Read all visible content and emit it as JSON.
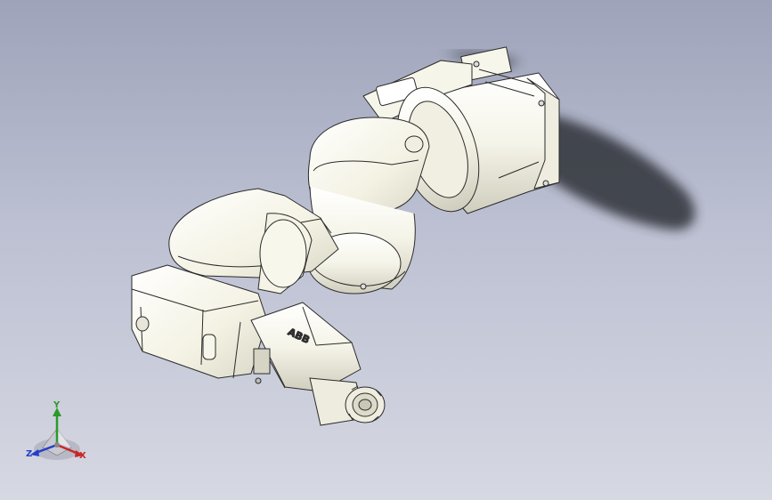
{
  "viewport": {
    "background_top": "#9ea3ba",
    "background_bottom": "#d6d8e2",
    "model_color": "#f4f2e4",
    "edge_color": "#2b2b2b",
    "shadow_color": "#2e2f36"
  },
  "model": {
    "brand_label": "ABB"
  },
  "triad": {
    "x_label": "X",
    "y_label": "Y",
    "z_label": "Z",
    "x_color": "#c62828",
    "y_color": "#2a9a2a",
    "z_color": "#2540c8"
  }
}
